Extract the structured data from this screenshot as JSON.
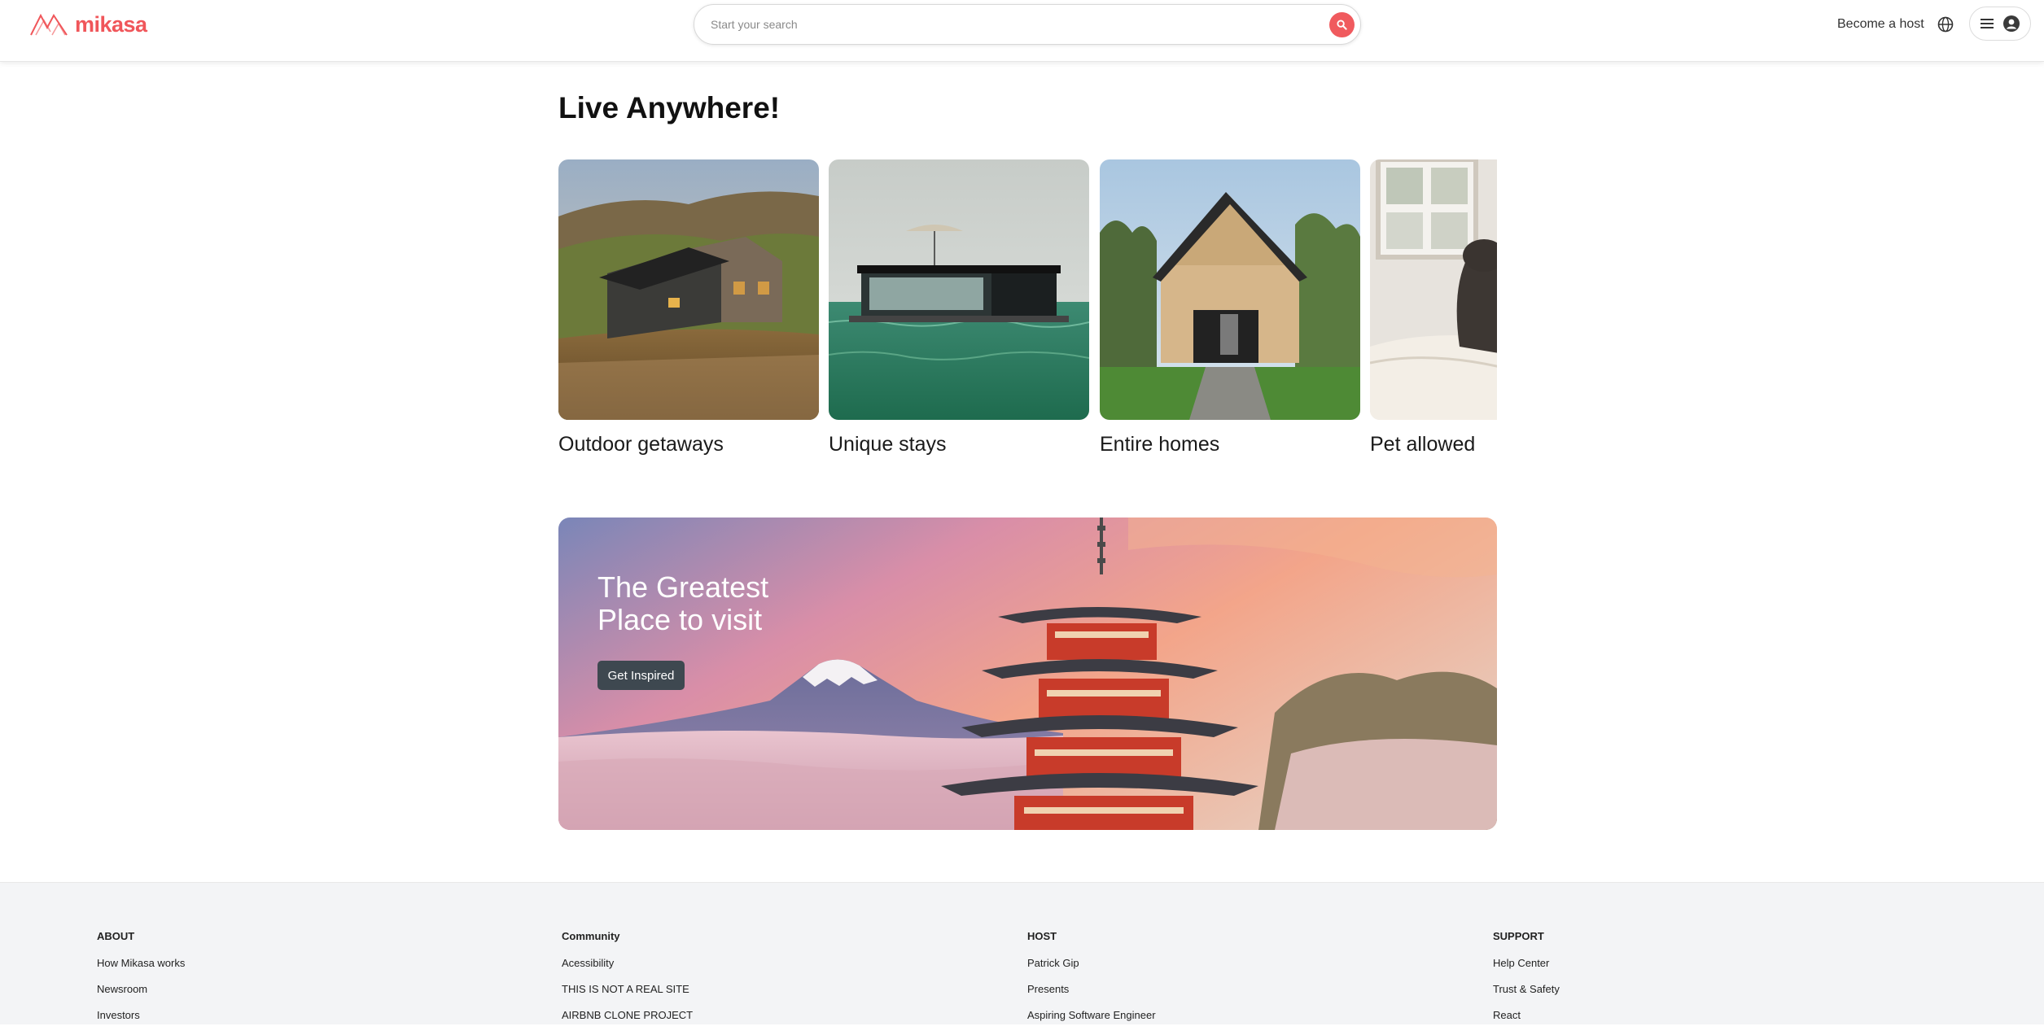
{
  "brand": {
    "name": "mikasa",
    "color": "#f0565a",
    "logo_icon": "mountains-logo-icon"
  },
  "search": {
    "placeholder": "Start your search",
    "icon": "search-icon"
  },
  "nav": {
    "become_host": "Become a host",
    "globe_icon": "globe-icon",
    "menu_icon": "hamburger-menu-icon",
    "avatar_icon": "user-avatar-icon"
  },
  "main": {
    "title": "Live Anywhere!",
    "categories": [
      {
        "label": "Outdoor getaways"
      },
      {
        "label": "Unique stays"
      },
      {
        "label": "Entire homes"
      },
      {
        "label": "Pet allowed"
      }
    ]
  },
  "banner": {
    "title": "The Greatest Place to visit",
    "button_label": "Get Inspired"
  },
  "footer": {
    "columns": [
      {
        "heading": "ABOUT",
        "links": [
          "How Mikasa works",
          "Newsroom",
          "Investors"
        ]
      },
      {
        "heading": "Community",
        "links": [
          "Acessibility",
          "THIS IS NOT A REAL SITE",
          "AIRBNB CLONE PROJECT"
        ]
      },
      {
        "heading": "HOST",
        "links": [
          "Patrick Gip",
          "Presents",
          "Aspiring Software Engineer"
        ]
      },
      {
        "heading": "SUPPORT",
        "links": [
          "Help Center",
          "Trust & Safety",
          "React"
        ]
      }
    ]
  }
}
